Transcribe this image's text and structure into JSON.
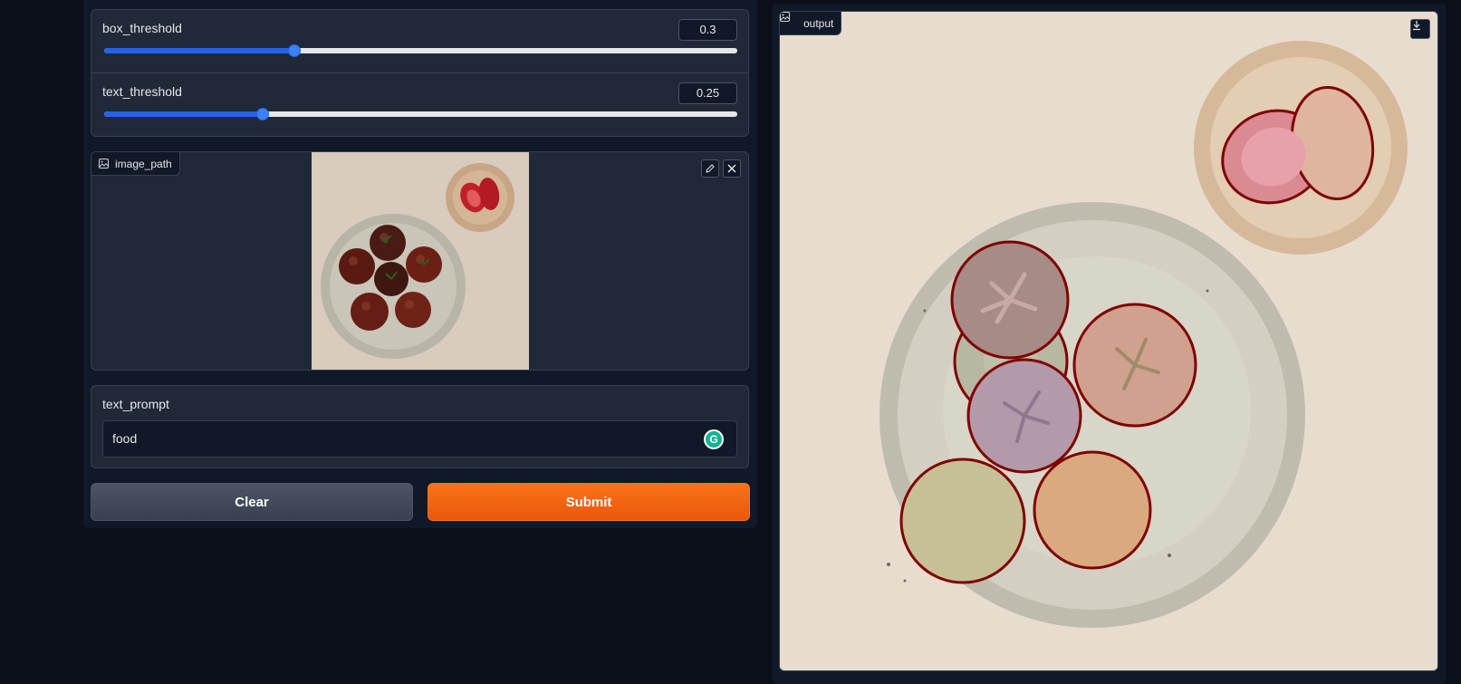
{
  "sliders": [
    {
      "label": "box_threshold",
      "value": "0.3",
      "fraction": 0.3
    },
    {
      "label": "text_threshold",
      "value": "0.25",
      "fraction": 0.25
    }
  ],
  "image_input": {
    "label": "image_path",
    "edit_icon": "pencil-icon",
    "clear_icon": "close-icon"
  },
  "text_prompt": {
    "label": "text_prompt",
    "value": "food",
    "assistant_badge": "G"
  },
  "buttons": {
    "clear": "Clear",
    "submit": "Submit"
  },
  "output": {
    "label": "output",
    "download_icon": "download-icon"
  },
  "colors": {
    "accent": "#3b82f6",
    "submit": "#f97316",
    "mask_outline": "#7f0000"
  }
}
